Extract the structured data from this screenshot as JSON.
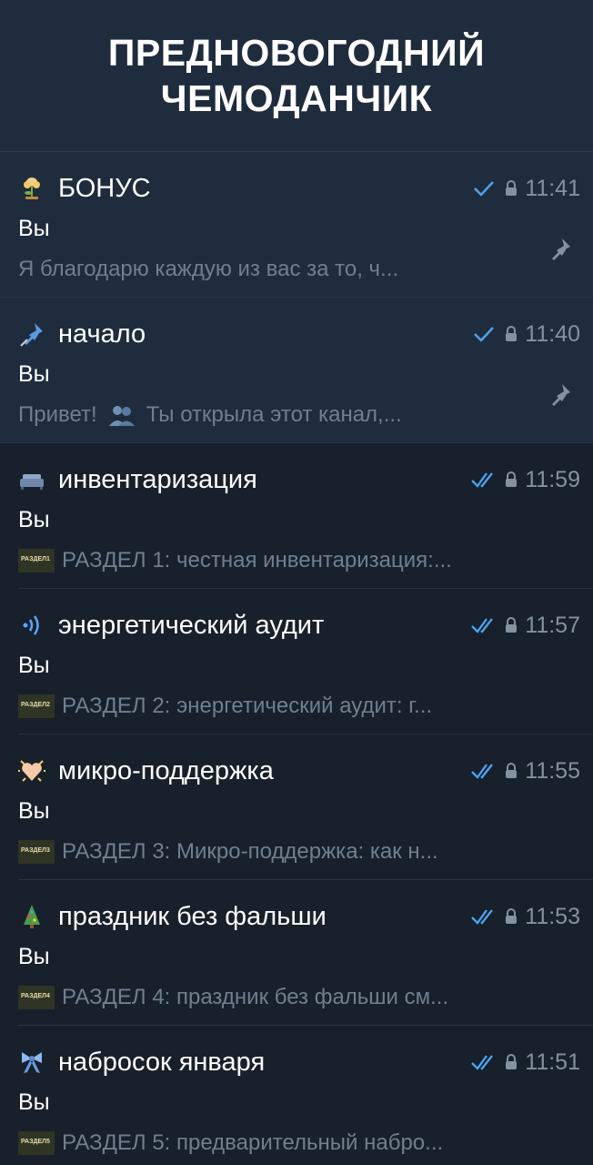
{
  "header": {
    "title_line1": "ПРЕДНОВОГОДНИЙ",
    "title_line2": "ЧЕМОДАНЧИК"
  },
  "chats": [
    {
      "icon": "flower-emoji-icon",
      "title": "БОНУС",
      "time": "11:41",
      "sender": "Вы",
      "preview": "Я благодарю каждую из вас за то, ч...",
      "pinned": true,
      "read": "single-check"
    },
    {
      "icon": "pushpin-emoji-icon",
      "title": "начало",
      "time": "11:40",
      "sender": "Вы",
      "preview_a": "Привет!",
      "preview_b": "Ты открыла этот канал,...",
      "pinned": true,
      "read": "single-check"
    },
    {
      "icon": "couch-emoji-icon",
      "title": "инвентаризация",
      "time": "11:59",
      "sender": "Вы",
      "thumb": "РАЗДЕЛ1",
      "preview": "РАЗДЕЛ 1: честная инвентаризация:...",
      "pinned": false,
      "read": "double-check"
    },
    {
      "icon": "signal-waves-icon",
      "title": "энергетический аудит",
      "time": "11:57",
      "sender": "Вы",
      "thumb": "РАЗДЕЛ2",
      "preview": "РАЗДЕЛ 2: энергетический аудит: г...",
      "pinned": false,
      "read": "double-check"
    },
    {
      "icon": "sparkling-heart-emoji-icon",
      "title": "микро-поддержка",
      "time": "11:55",
      "sender": "Вы",
      "thumb": "РАЗДЕЛ3",
      "preview": "РАЗДЕЛ 3: Микро-поддержка: как н...",
      "pinned": false,
      "read": "double-check"
    },
    {
      "icon": "christmas-tree-emoji-icon",
      "title": "праздник без фальши",
      "time": "11:53",
      "sender": "Вы",
      "thumb": "РАЗДЕЛ4",
      "preview": "РАЗДЕЛ 4: праздник без фальши см...",
      "pinned": false,
      "read": "double-check"
    },
    {
      "icon": "ribbon-emoji-icon",
      "title": "набросок января",
      "time": "11:51",
      "sender": "Вы",
      "thumb": "РАЗДЕЛ5",
      "preview": "РАЗДЕЛ 5: предварительный набро...",
      "pinned": false,
      "read": "double-check"
    }
  ],
  "colors": {
    "background": "#17202b",
    "pinned_background": "#1f2c3d",
    "accent_check": "#4ba3f2",
    "secondary_text": "#707f90"
  }
}
